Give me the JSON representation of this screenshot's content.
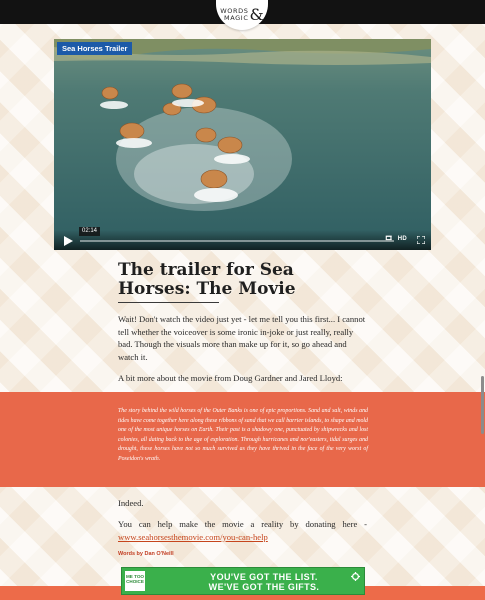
{
  "header": {
    "logo_word1": "WORDS",
    "logo_word2": "MAGIC",
    "logo_amp": "&"
  },
  "video": {
    "title": "Sea Horses Trailer",
    "timecode": "02:14",
    "hd_label": "HD",
    "vimeo_label": "🎞",
    "icons": {
      "play": "play-icon",
      "fullscreen": "fullscreen-icon"
    }
  },
  "article": {
    "headline": "The trailer for Sea Horses: The Movie",
    "paragraph1": "Wait! Don't watch the video just yet - let me tell you this first... I cannot tell whether the voiceover is some ironic in-joke or just really, really bad. Though the visuals more than make up for it, so go ahead and watch it.",
    "paragraph2": "A bit more about the movie from Doug Gardner and Jared Lloyd:",
    "quote": "The story behind the wild horses of the Outer Banks is one of epic proportions. Sand and salt, winds and tides have come together here along these ribbons of sand that we call barrier islands, to shape and mold one of the most unique horses on Earth. Their past is a shadowy one, punctuated by shipwrecks and lost colonies, all dating back to the age of exploration. Through hurricanes and nor'easters, tidal surges and drought, these horses have not so much survived as they have thrived in the face of the very worst of Poseidon's wrath.",
    "indeed": "Indeed.",
    "donate_text": "You can help make the movie a reality by donating here -",
    "donate_link": "www.seahorsesthemovie.com/you-can-help",
    "byline": "Words by Dan O'Neill"
  },
  "ad": {
    "logo_text": "ME TOO CHOICE",
    "line1": "YOU'VE GOT THE LIST.",
    "line2": "WE'VE GOT THE GIFTS."
  },
  "colors": {
    "accent": "#e8684a",
    "header": "#121212",
    "ad_green": "#3ab04b",
    "link": "#c6451d"
  }
}
